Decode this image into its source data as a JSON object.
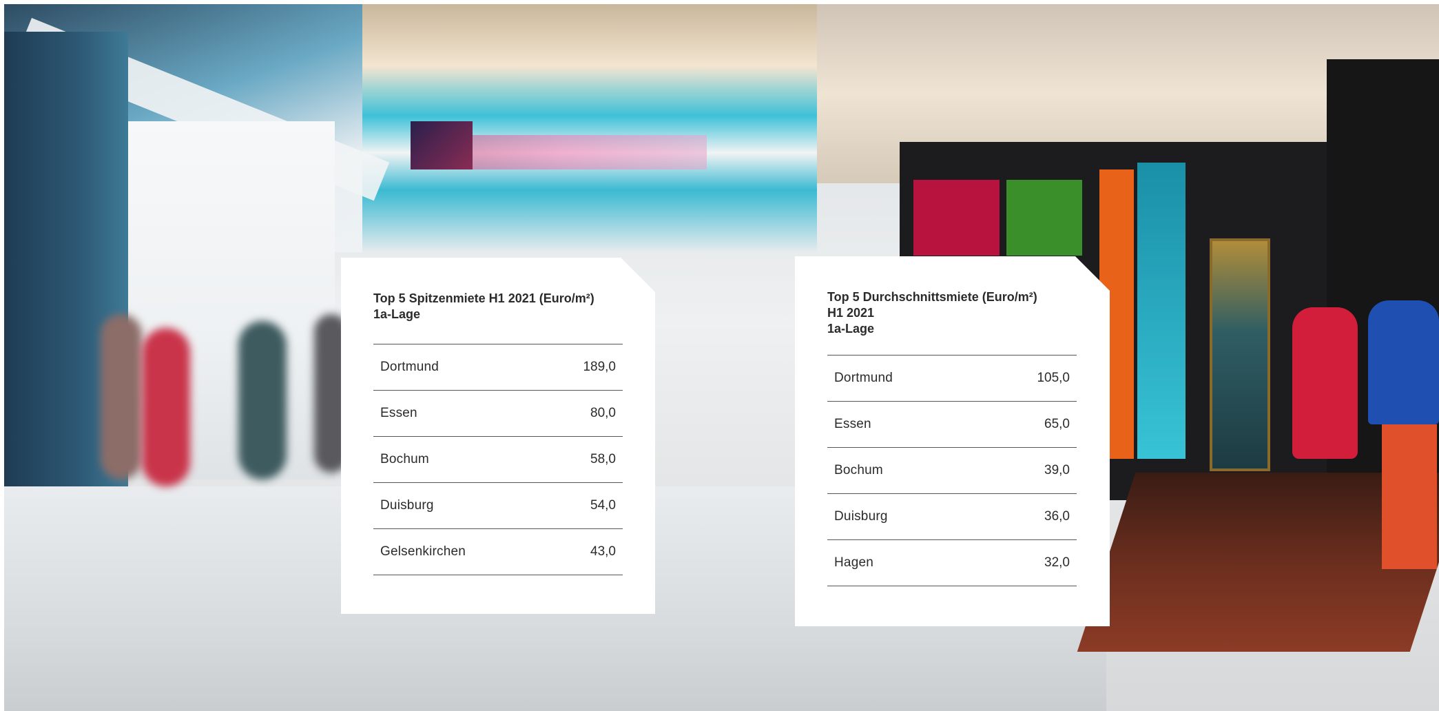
{
  "table_left": {
    "title_lines": [
      "Top 5 Spitzenmiete H1 2021 (Euro/m²)",
      "1a-Lage"
    ],
    "rows": [
      {
        "city": "Dortmund",
        "value": "189,0"
      },
      {
        "city": "Essen",
        "value": "80,0"
      },
      {
        "city": "Bochum",
        "value": "58,0"
      },
      {
        "city": "Duisburg",
        "value": "54,0"
      },
      {
        "city": "Gelsenkirchen",
        "value": "43,0"
      }
    ]
  },
  "table_right": {
    "title_lines": [
      "Top 5 Durchschnittsmiete (Euro/m²)",
      "H1 2021",
      "1a-Lage"
    ],
    "rows": [
      {
        "city": "Dortmund",
        "value": "105,0"
      },
      {
        "city": "Essen",
        "value": "65,0"
      },
      {
        "city": "Bochum",
        "value": "39,0"
      },
      {
        "city": "Duisburg",
        "value": "36,0"
      },
      {
        "city": "Hagen",
        "value": "32,0"
      }
    ]
  }
}
